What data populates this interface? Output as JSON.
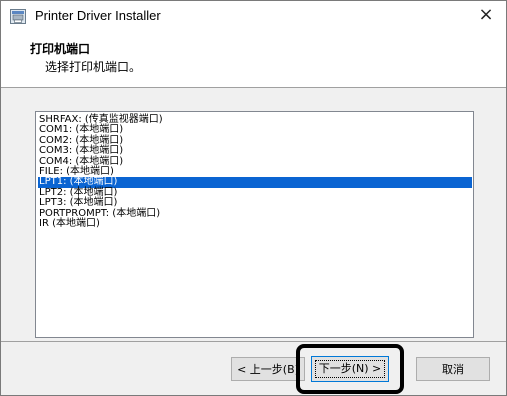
{
  "window": {
    "title": "Printer Driver Installer",
    "close_glyph": "×"
  },
  "header": {
    "title": "打印机端口",
    "subtitle": "选择打印机端口。"
  },
  "ports": [
    "SHRFAX: (传真监视器端口)",
    "COM1: (本地端口)",
    "COM2: (本地端口)",
    "COM3: (本地端口)",
    "COM4: (本地端口)",
    "FILE: (本地端口)",
    "LPT1: (本地端口)",
    "LPT2: (本地端口)",
    "LPT3: (本地端口)",
    "PORTPROMPT: (本地端口)",
    "IR (本地端口)"
  ],
  "selected_port_index": 6,
  "buttons": {
    "back": "< 上一步(B)",
    "next": "下一步(N) >",
    "cancel": "取消"
  },
  "colors": {
    "selection": "#0a64d2",
    "highlight_box": "#000000"
  },
  "icons": {
    "app": "printer-installer-icon",
    "close": "close-icon"
  }
}
